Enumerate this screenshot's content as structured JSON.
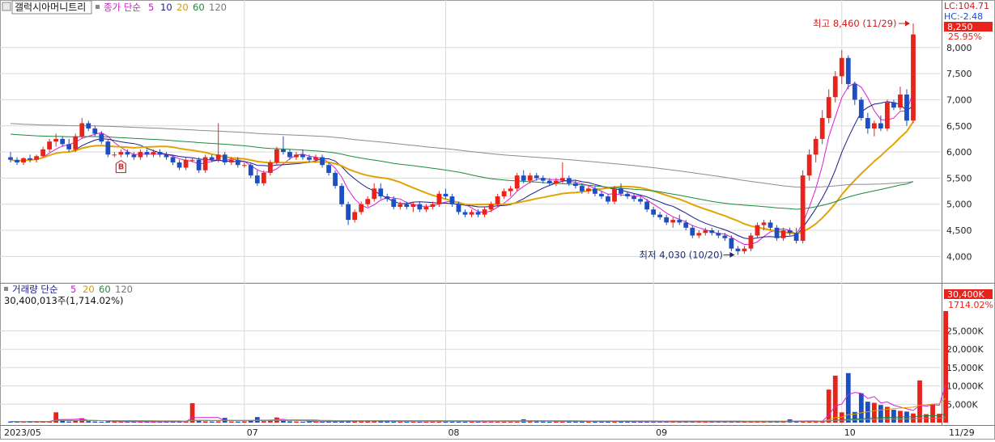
{
  "price_panel": {
    "stock_name": "갤럭시아머니트리",
    "ma_legend": {
      "prefix": "종가 단순",
      "periods": [
        "5",
        "10",
        "20",
        "60",
        "120"
      ]
    },
    "lc_label": "LC:104.71",
    "hc_label": "HC:-2.48",
    "last_price_tag": "8,250",
    "change_pct_tag": "25.95%",
    "high_annotation": "최고 8,460 (11/29)",
    "low_annotation": "최저 4,030 (10/20)",
    "y_ticks": [
      "4,000",
      "4,500",
      "5,000",
      "5,500",
      "6,000",
      "6,500",
      "7,000",
      "7,500",
      "8,000"
    ]
  },
  "volume_panel": {
    "ma_legend": {
      "prefix": "거래량 단순",
      "periods": [
        "5",
        "20",
        "60",
        "120"
      ]
    },
    "volume_text": "30,400,013주(1,714.02%)",
    "last_volume_tag": "30,400K",
    "volume_pct_tag": "1714.02%",
    "y_ticks": [
      "5,000K",
      "10,000K",
      "15,000K",
      "20,000K",
      "25,000K"
    ]
  },
  "x_axis": {
    "labels": [
      "2023/05",
      "07",
      "08",
      "09",
      "10",
      "11"
    ],
    "last_date": "11/29"
  },
  "colors": {
    "up": "#e8231c",
    "down": "#1d4fc4",
    "ma5": "#d81fd8",
    "ma10": "#1b1b8f",
    "ma20": "#e2a400",
    "ma60": "#1d8a3c",
    "ma120": "#8c8c8c",
    "grid": "#d9d9d9",
    "axis": "#7a7a7a",
    "signal_blue": "#1d3ea8",
    "signal_red": "#d62b2b"
  },
  "chart_data": [
    {
      "type": "candlestick",
      "y_axis_label": "price",
      "ylim": [
        3650,
        8600
      ],
      "x_anchors": [
        {
          "date": "2023/05",
          "index": 0
        },
        {
          "date": "07",
          "index": 36
        },
        {
          "date": "08",
          "index": 67
        },
        {
          "date": "09",
          "index": 99
        },
        {
          "date": "10",
          "index": 128
        },
        {
          "date": "11",
          "index": 155
        },
        {
          "date": "11/29",
          "index": 186
        }
      ],
      "candles": [
        [
          5900,
          6000,
          5800,
          5850
        ],
        [
          5850,
          5900,
          5750,
          5800
        ],
        [
          5800,
          5900,
          5750,
          5880
        ],
        [
          5880,
          5950,
          5800,
          5850
        ],
        [
          5850,
          5950,
          5800,
          5920
        ],
        [
          5920,
          6100,
          5900,
          6050
        ],
        [
          6050,
          6250,
          6000,
          6200
        ],
        [
          6200,
          6350,
          6100,
          6250
        ],
        [
          6250,
          6300,
          6100,
          6150
        ],
        [
          6150,
          6250,
          6000,
          6050
        ],
        [
          6050,
          6350,
          6000,
          6300
        ],
        [
          6300,
          6650,
          6250,
          6550
        ],
        [
          6550,
          6600,
          6400,
          6450
        ],
        [
          6450,
          6500,
          6300,
          6350
        ],
        [
          6350,
          6400,
          6150,
          6200
        ],
        [
          6200,
          6250,
          5900,
          5950
        ],
        [
          5950,
          6000,
          5900,
          5950
        ],
        [
          5950,
          6050,
          5900,
          6000
        ],
        [
          6000,
          6050,
          5900,
          5950
        ],
        [
          5950,
          6000,
          5850,
          5900
        ],
        [
          5900,
          6050,
          5850,
          6000
        ],
        [
          6000,
          6050,
          5900,
          5950
        ],
        [
          5950,
          6050,
          5900,
          6000
        ],
        [
          6000,
          6050,
          5900,
          5950
        ],
        [
          5950,
          6000,
          5850,
          5900
        ],
        [
          5900,
          5950,
          5750,
          5800
        ],
        [
          5800,
          5850,
          5650,
          5700
        ],
        [
          5700,
          5900,
          5650,
          5850
        ],
        [
          5850,
          5900,
          5800,
          5850
        ],
        [
          5850,
          5900,
          5600,
          5650
        ],
        [
          5650,
          5950,
          5600,
          5900
        ],
        [
          5900,
          5950,
          5800,
          5850
        ],
        [
          5850,
          6550,
          5800,
          5950
        ],
        [
          5950,
          6000,
          5750,
          5800
        ],
        [
          5800,
          5900,
          5750,
          5850
        ],
        [
          5850,
          5900,
          5700,
          5750
        ],
        [
          5750,
          5800,
          5700,
          5750
        ],
        [
          5750,
          5800,
          5500,
          5550
        ],
        [
          5550,
          5650,
          5350,
          5400
        ],
        [
          5400,
          5650,
          5350,
          5600
        ],
        [
          5600,
          5850,
          5550,
          5800
        ],
        [
          5800,
          6100,
          5750,
          6050
        ],
        [
          6050,
          6300,
          5950,
          6000
        ],
        [
          6000,
          6050,
          5850,
          5900
        ],
        [
          5900,
          6000,
          5850,
          5950
        ],
        [
          5950,
          6050,
          5850,
          5900
        ],
        [
          5900,
          5950,
          5800,
          5850
        ],
        [
          5850,
          5950,
          5800,
          5900
        ],
        [
          5900,
          5950,
          5700,
          5750
        ],
        [
          5750,
          5800,
          5550,
          5600
        ],
        [
          5600,
          5650,
          5300,
          5350
        ],
        [
          5350,
          5400,
          4950,
          5000
        ],
        [
          5000,
          5050,
          4600,
          4700
        ],
        [
          4700,
          4900,
          4650,
          4850
        ],
        [
          4850,
          5050,
          4800,
          5000
        ],
        [
          5000,
          5150,
          4950,
          5100
        ],
        [
          5100,
          5400,
          5050,
          5300
        ],
        [
          5300,
          5400,
          5100,
          5150
        ],
        [
          5150,
          5200,
          5050,
          5100
        ],
        [
          5100,
          5150,
          4900,
          4950
        ],
        [
          4950,
          5050,
          4900,
          5000
        ],
        [
          5000,
          5050,
          4900,
          4950
        ],
        [
          4950,
          5050,
          4850,
          5000
        ],
        [
          5000,
          5050,
          4850,
          4900
        ],
        [
          4900,
          5000,
          4850,
          4950
        ],
        [
          4950,
          5050,
          4900,
          5000
        ],
        [
          5000,
          5250,
          4950,
          5200
        ],
        [
          5200,
          5300,
          5100,
          5150
        ],
        [
          5150,
          5200,
          4950,
          5000
        ],
        [
          5000,
          5050,
          4800,
          4850
        ],
        [
          4850,
          4900,
          4750,
          4800
        ],
        [
          4800,
          4900,
          4750,
          4850
        ],
        [
          4850,
          4900,
          4750,
          4800
        ],
        [
          4800,
          4950,
          4750,
          4900
        ],
        [
          4900,
          5050,
          4850,
          5000
        ],
        [
          5000,
          5200,
          4950,
          5150
        ],
        [
          5150,
          5300,
          5100,
          5250
        ],
        [
          5250,
          5350,
          5150,
          5300
        ],
        [
          5300,
          5600,
          5250,
          5550
        ],
        [
          5550,
          5650,
          5400,
          5450
        ],
        [
          5450,
          5600,
          5400,
          5550
        ],
        [
          5550,
          5600,
          5450,
          5500
        ],
        [
          5500,
          5550,
          5400,
          5450
        ],
        [
          5450,
          5500,
          5350,
          5400
        ],
        [
          5400,
          5500,
          5350,
          5450
        ],
        [
          5450,
          5800,
          5400,
          5500
        ],
        [
          5500,
          5550,
          5350,
          5400
        ],
        [
          5400,
          5450,
          5300,
          5350
        ],
        [
          5350,
          5400,
          5200,
          5250
        ],
        [
          5250,
          5350,
          5200,
          5300
        ],
        [
          5300,
          5350,
          5150,
          5200
        ],
        [
          5200,
          5250,
          5100,
          5150
        ],
        [
          5150,
          5200,
          5000,
          5050
        ],
        [
          5050,
          5350,
          5000,
          5300
        ],
        [
          5300,
          5400,
          5150,
          5200
        ],
        [
          5200,
          5250,
          5100,
          5150
        ],
        [
          5150,
          5200,
          5050,
          5100
        ],
        [
          5100,
          5150,
          5000,
          5050
        ],
        [
          5050,
          5100,
          4850,
          4900
        ],
        [
          4900,
          4950,
          4750,
          4800
        ],
        [
          4800,
          4850,
          4700,
          4750
        ],
        [
          4750,
          4800,
          4600,
          4650
        ],
        [
          4650,
          4750,
          4550,
          4700
        ],
        [
          4700,
          4800,
          4600,
          4650
        ],
        [
          4650,
          4700,
          4500,
          4550
        ],
        [
          4550,
          4600,
          4350,
          4400
        ],
        [
          4400,
          4500,
          4350,
          4450
        ],
        [
          4450,
          4550,
          4400,
          4500
        ],
        [
          4500,
          4550,
          4400,
          4450
        ],
        [
          4450,
          4500,
          4350,
          4400
        ],
        [
          4400,
          4450,
          4300,
          4350
        ],
        [
          4350,
          4400,
          4100,
          4150
        ],
        [
          4150,
          4200,
          4030,
          4100
        ],
        [
          4100,
          4200,
          4050,
          4150
        ],
        [
          4150,
          4450,
          4100,
          4400
        ],
        [
          4400,
          4650,
          4350,
          4600
        ],
        [
          4600,
          4700,
          4500,
          4650
        ],
        [
          4650,
          4700,
          4500,
          4550
        ],
        [
          4550,
          4600,
          4300,
          4350
        ],
        [
          4350,
          4550,
          4300,
          4500
        ],
        [
          4500,
          4550,
          4400,
          4450
        ],
        [
          4450,
          4550,
          4250,
          4300
        ],
        [
          4300,
          5650,
          4250,
          5550
        ],
        [
          5550,
          6050,
          5450,
          5950
        ],
        [
          5950,
          6300,
          5800,
          6250
        ],
        [
          6250,
          6800,
          6150,
          6650
        ],
        [
          6650,
          7200,
          6550,
          7050
        ],
        [
          7050,
          7550,
          6950,
          7450
        ],
        [
          7450,
          7950,
          7300,
          7800
        ],
        [
          7800,
          7850,
          7200,
          7300
        ],
        [
          7300,
          7350,
          6900,
          7000
        ],
        [
          7000,
          7050,
          6600,
          6650
        ],
        [
          6650,
          6750,
          6350,
          6450
        ],
        [
          6450,
          6600,
          6300,
          6550
        ],
        [
          6550,
          6700,
          6400,
          6450
        ],
        [
          6450,
          7000,
          6400,
          6950
        ],
        [
          6950,
          7000,
          6800,
          6850
        ],
        [
          6850,
          7250,
          6800,
          7100
        ],
        [
          7100,
          7200,
          6500,
          6600
        ],
        [
          6600,
          8460,
          6550,
          8250
        ]
      ],
      "ma_series": [
        {
          "name": "5",
          "values": []
        },
        {
          "name": "10",
          "values": []
        },
        {
          "name": "20",
          "values": []
        },
        {
          "name": "60",
          "values": []
        },
        {
          "name": "120",
          "values": []
        }
      ],
      "signals": [
        {
          "label": "S",
          "index": 155,
          "kind": "sell"
        },
        {
          "label": "B",
          "index": 164,
          "kind": "buy"
        },
        {
          "label": "B",
          "index": 166,
          "kind": "buy"
        },
        {
          "label": "B",
          "index": 168,
          "kind": "buy"
        },
        {
          "label": "B",
          "index": 169,
          "kind": "buy"
        },
        {
          "label": "S",
          "index": 171,
          "kind": "sell"
        },
        {
          "label": "S",
          "index": 175,
          "kind": "sell"
        },
        {
          "label": "B",
          "index": 17,
          "kind": "buy"
        }
      ],
      "high": {
        "value": 8460,
        "date": "11/29"
      },
      "low": {
        "value": 4030,
        "date": "10/20"
      }
    },
    {
      "type": "bar",
      "y_axis_label": "volume",
      "unit": "K",
      "ylim": [
        0,
        31500
      ],
      "volumes_k": [
        300,
        250,
        200,
        300,
        250,
        400,
        350,
        2800,
        500,
        300,
        600,
        1200,
        400,
        300,
        250,
        350,
        300,
        250,
        200,
        200,
        250,
        300,
        250,
        200,
        250,
        350,
        300,
        450,
        5300,
        500,
        350,
        300,
        350,
        1300,
        300,
        250,
        300,
        450,
        1500,
        400,
        600,
        1400,
        600,
        350,
        300,
        250,
        300,
        250,
        300,
        400,
        350,
        300,
        600,
        400,
        300,
        350,
        500,
        400,
        350,
        300,
        250,
        300,
        350,
        250,
        300,
        300,
        500,
        350,
        300,
        350,
        250,
        300,
        250,
        300,
        350,
        400,
        500,
        400,
        350,
        900,
        400,
        350,
        300,
        250,
        300,
        300,
        450,
        350,
        300,
        250,
        300,
        350,
        400,
        300,
        250,
        300,
        250,
        300,
        250,
        200,
        250,
        300,
        250,
        200,
        250,
        300,
        250,
        200,
        250,
        300,
        250,
        200,
        300,
        250,
        300,
        250,
        200,
        250,
        300,
        350,
        900,
        400,
        300,
        350,
        400,
        300,
        9000,
        12800,
        2800,
        13500,
        2900,
        8000,
        5700,
        5400,
        4800,
        4300,
        3500,
        3200,
        3000,
        2500,
        11500,
        2300,
        5000,
        2400,
        30400
      ],
      "volume_ma": [
        {
          "name": "5",
          "values": []
        },
        {
          "name": "20",
          "values": []
        },
        {
          "name": "60",
          "values": []
        },
        {
          "name": "120",
          "values": []
        }
      ]
    }
  ]
}
